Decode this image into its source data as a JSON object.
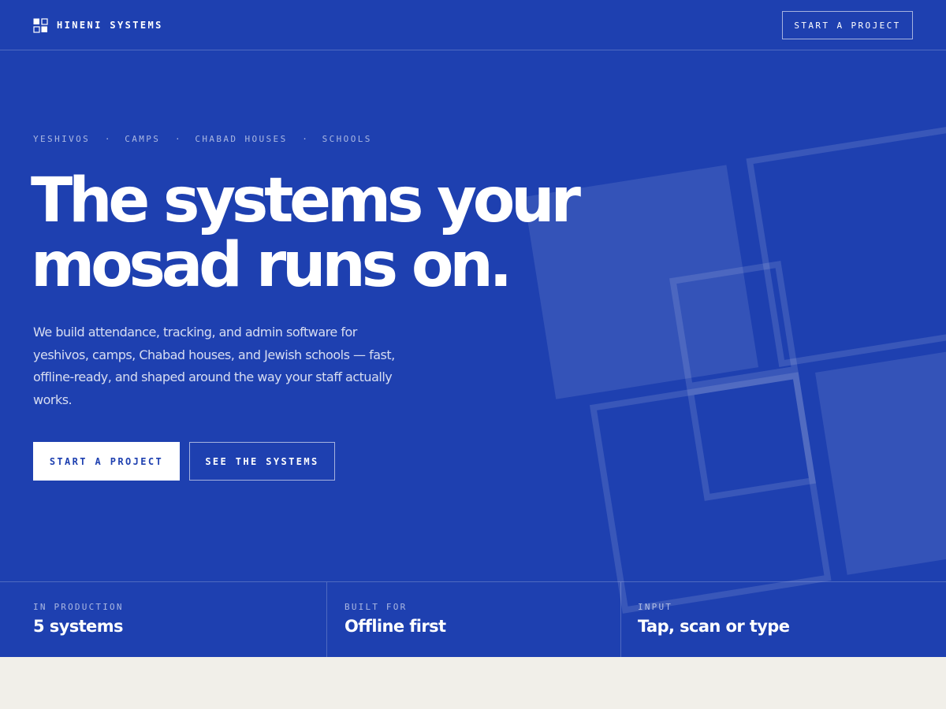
{
  "colors": {
    "hero_background": "#1e40b0",
    "accent_white": "#ffffff",
    "below_background": "#f1efe9"
  },
  "nav": {
    "brand_name": "HINENI SYSTEMS",
    "brand_icon": "grid-squares-icon",
    "cta_label": "START A PROJECT"
  },
  "hero": {
    "audiences": [
      "YESHIVOS",
      "CAMPS",
      "CHABAD HOUSES",
      "SCHOOLS"
    ],
    "separator": "·",
    "headline_line1": "The systems your",
    "headline_line2": "mosad runs on.",
    "lede": "We build attendance, tracking, and admin software for yeshivos, camps, Chabad houses, and Jewish schools — fast, offline-ready, and shaped around the way your staff actually works.",
    "primary_button": "START A PROJECT",
    "secondary_button": "SEE THE SYSTEMS",
    "decoration_icon": "tilted-squares-graphic"
  },
  "stats": [
    {
      "label": "IN PRODUCTION",
      "value": "5 systems"
    },
    {
      "label": "BUILT FOR",
      "value": "Offline first"
    },
    {
      "label": "INPUT",
      "value": "Tap, scan or type"
    }
  ]
}
